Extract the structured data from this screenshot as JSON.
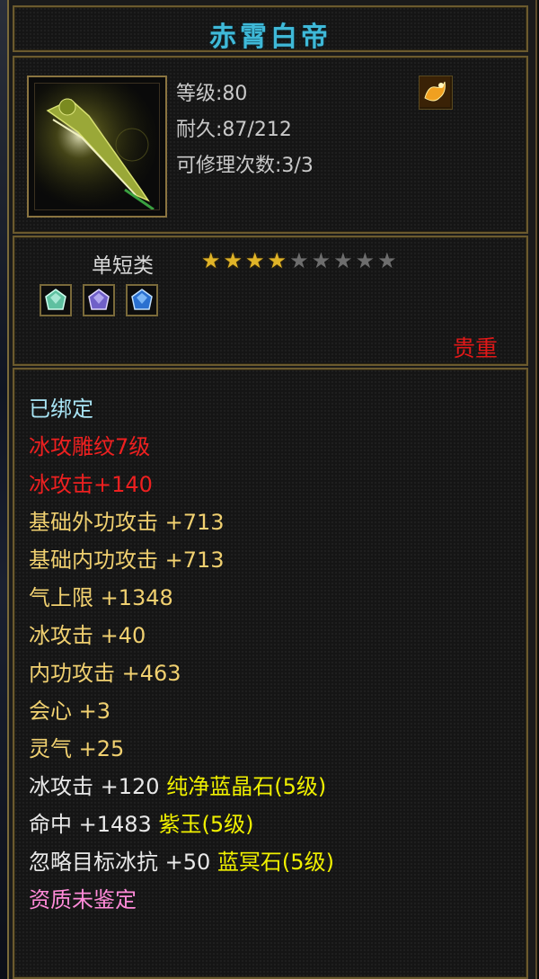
{
  "item": {
    "name": "赤霄白帝",
    "level_label": "等级:80",
    "durability_label": "耐久:87/212",
    "repair_label": "可修理次数:3/3",
    "weapon_type": "单短类",
    "stars_filled": 4,
    "stars_total": 9,
    "rarity": "贵重",
    "sockets": [
      {
        "icon": "green-gem-icon",
        "color": "#7fd7b0"
      },
      {
        "icon": "purple-gem-icon",
        "color": "#8a7ae0"
      },
      {
        "icon": "blue-gem-icon",
        "color": "#3a8ae0"
      }
    ]
  },
  "attributes": {
    "bound": "已绑定",
    "engrave": "冰攻雕纹7级",
    "ice_attack": "冰攻击+140",
    "lines": [
      {
        "label": "基础外功攻击",
        "value": "+713"
      },
      {
        "label": "基础内功攻击",
        "value": "+713"
      },
      {
        "label": "气上限",
        "value": "+1348"
      },
      {
        "label": "冰攻击",
        "value": "+40"
      },
      {
        "label": "内功攻击",
        "value": "+463"
      },
      {
        "label": "会心",
        "value": "+3"
      },
      {
        "label": "灵气",
        "value": "+25"
      }
    ],
    "gem_lines": [
      {
        "label": "冰攻击",
        "value": "+120",
        "gem": "纯净蓝晶石(5级)"
      },
      {
        "label": "命中",
        "value": "+1483",
        "gem": "紫玉(5级)"
      },
      {
        "label": "忽略目标冰抗",
        "value": "+50",
        "gem": "蓝冥石(5级)"
      }
    ],
    "quality": "资质未鉴定"
  },
  "colors": {
    "title": "#3fb9d8",
    "rarity": "#e01818",
    "attribute_gold": "#f0d070",
    "gem_yellow": "#f0f000",
    "quality_pink": "#ff8ad8"
  }
}
